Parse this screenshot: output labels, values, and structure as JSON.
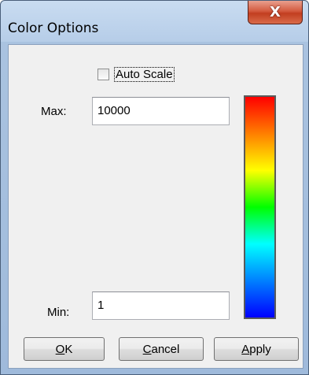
{
  "window": {
    "title": "Color Options",
    "close_glyph": "X"
  },
  "options": {
    "auto_scale_label": "Auto Scale",
    "auto_scale_checked": false,
    "max_label": "Max:",
    "max_value": "10000",
    "min_label": "Min:",
    "min_value": "1"
  },
  "colorbar": {
    "colors": [
      "#ff0000",
      "#ff7f00",
      "#ffff00",
      "#00ff00",
      "#00ffff",
      "#0080ff",
      "#0000ff"
    ]
  },
  "buttons": {
    "ok": {
      "mnemonic": "O",
      "rest": "K"
    },
    "cancel": {
      "mnemonic": "C",
      "rest": "ancel"
    },
    "apply": {
      "mnemonic": "A",
      "rest": "pply"
    }
  }
}
